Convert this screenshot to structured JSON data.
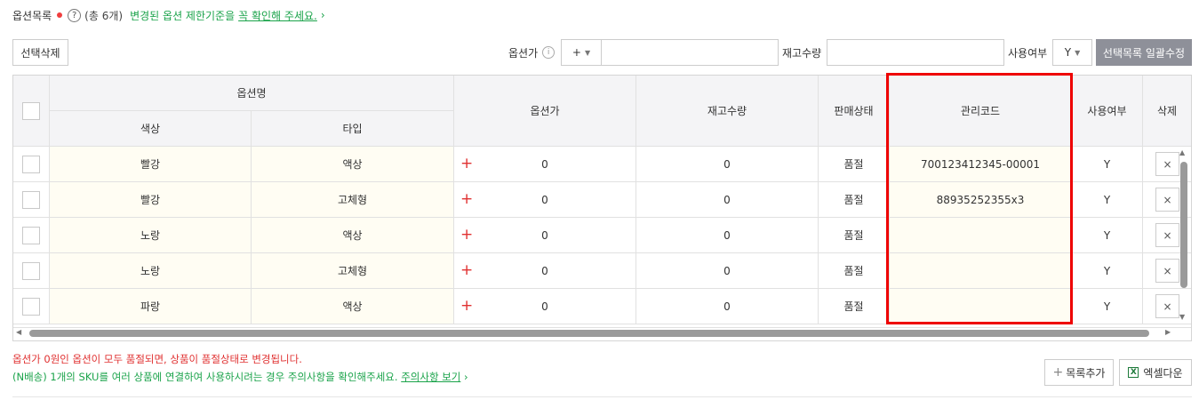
{
  "header": {
    "title": "옵션목록",
    "help_icon": "?",
    "count_prefix": "(총 ",
    "count": "6",
    "count_suffix": "개)",
    "notice_text": "변경된 옵션 제한기준을 ",
    "notice_link": "꼭 확인해 주세요.",
    "chevron": "›"
  },
  "toolbar": {
    "delete_label": "선택삭제",
    "price_label": "옵션가",
    "price_sign": "+",
    "stock_label": "재고수량",
    "usage_label": "사용여부",
    "usage_value": "Y",
    "bulk_label": "선택목록 일괄수정"
  },
  "table": {
    "group_header": "옵션명",
    "columns": {
      "color": "색상",
      "type": "타입",
      "price": "옵션가",
      "stock": "재고수량",
      "status": "판매상태",
      "code": "관리코드",
      "usage": "사용여부",
      "delete": "삭제"
    },
    "rows": [
      {
        "color": "빨강",
        "type": "액상",
        "sign": "+",
        "price": "0",
        "stock": "0",
        "status": "품절",
        "code": "700123412345-00001",
        "usage": "Y",
        "del": "×"
      },
      {
        "color": "빨강",
        "type": "고체형",
        "sign": "+",
        "price": "0",
        "stock": "0",
        "status": "품절",
        "code": "88935252355x3",
        "usage": "Y",
        "del": "×"
      },
      {
        "color": "노랑",
        "type": "액상",
        "sign": "+",
        "price": "0",
        "stock": "0",
        "status": "품절",
        "code": "",
        "usage": "Y",
        "del": "×"
      },
      {
        "color": "노랑",
        "type": "고체형",
        "sign": "+",
        "price": "0",
        "stock": "0",
        "status": "품절",
        "code": "",
        "usage": "Y",
        "del": "×"
      },
      {
        "color": "파랑",
        "type": "액상",
        "sign": "+",
        "price": "0",
        "stock": "0",
        "status": "품절",
        "code": "",
        "usage": "Y",
        "del": "×"
      }
    ]
  },
  "footer": {
    "warning": "옵션가 0원인 옵션이 모두 품절되면, 상품이 품절상태로 변경됩니다.",
    "nship_text": "(N배송) 1개의 SKU를 여러 상품에 연결하여 사용하시려는 경우 주의사항을 확인해주세요. ",
    "nship_link": "주의사항 보기",
    "nship_chevron": "›",
    "add_row_icon": "+",
    "add_row_label": "목록추가",
    "excel_icon": "X",
    "excel_label": "엑셀다운"
  },
  "colors": {
    "notice_green": "#1aa34a",
    "warning_red": "#e03131",
    "highlight_border": "#ee0000",
    "bulk_button": "#8e9099"
  }
}
